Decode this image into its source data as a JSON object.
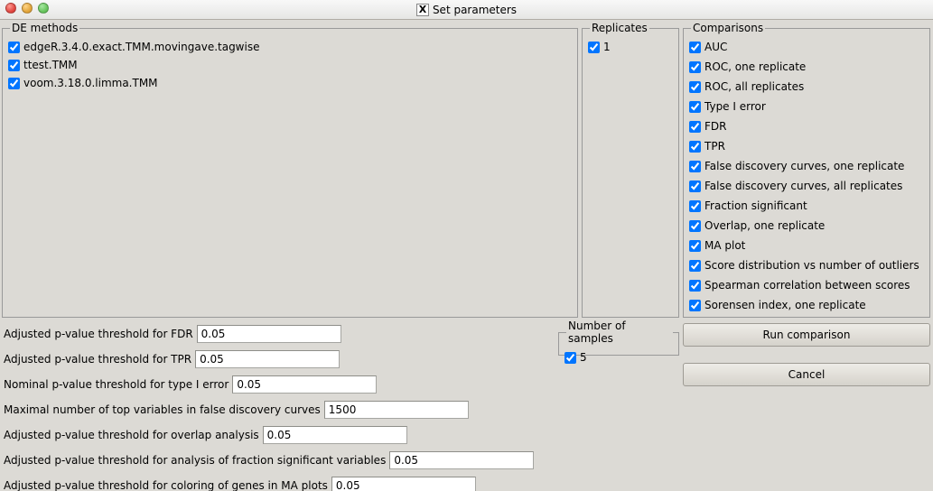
{
  "window": {
    "title": "Set parameters"
  },
  "de_methods": {
    "legend": "DE methods",
    "items": [
      "edgeR.3.4.0.exact.TMM.movingave.tagwise",
      "ttest.TMM",
      "voom.3.18.0.limma.TMM"
    ]
  },
  "replicates": {
    "legend": "Replicates",
    "items": [
      "1"
    ]
  },
  "comparisons": {
    "legend": "Comparisons",
    "items": [
      "AUC",
      "ROC, one replicate",
      "ROC, all replicates",
      "Type I error",
      "FDR",
      "TPR",
      "False discovery curves, one replicate",
      "False discovery curves, all replicates",
      "Fraction significant",
      "Overlap, one replicate",
      "MA plot",
      "Score distribution vs number of outliers",
      "Spearman correlation between scores",
      "Sorensen index, one replicate"
    ]
  },
  "samples": {
    "legend": "Number of samples",
    "items": [
      "5"
    ]
  },
  "params": {
    "fdr_label": "Adjusted p-value threshold for FDR",
    "fdr_value": "0.05",
    "tpr_label": "Adjusted p-value threshold for TPR",
    "tpr_value": "0.05",
    "type1_label": "Nominal p-value threshold for type I error",
    "type1_value": "0.05",
    "fdc_label": "Maximal number of top variables in false discovery curves",
    "fdc_value": "1500",
    "overlap_label": "Adjusted p-value threshold for overlap analysis",
    "overlap_value": "0.05",
    "fracsig_label": "Adjusted p-value threshold for analysis of fraction significant variables",
    "fracsig_value": "0.05",
    "ma_label": "Adjusted p-value threshold for coloring of genes in MA plots",
    "ma_value": "0.05"
  },
  "buttons": {
    "run": "Run comparison",
    "cancel": "Cancel"
  }
}
